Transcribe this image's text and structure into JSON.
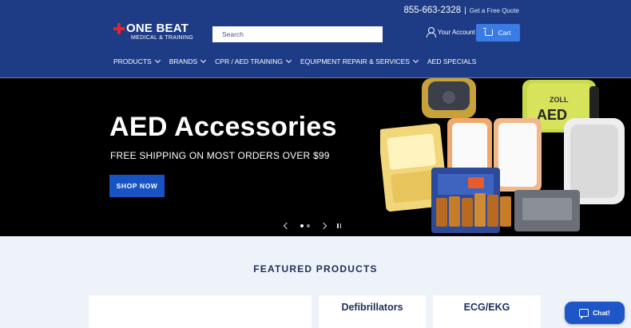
{
  "header": {
    "phone": "855-663-2328",
    "separator": "|",
    "quote_link": "Get a Free Quote",
    "logo_line1": "ONE BEAT",
    "logo_line2": "MEDICAL & TRAINING",
    "search_placeholder": "Search",
    "account_label": "Your Account",
    "cart_label": "Cart",
    "colors": {
      "header_bg": "#1d3c85",
      "logo_cross": "#e4232a",
      "cart_bg": "#3a7be6"
    }
  },
  "nav": {
    "items": [
      {
        "label": "PRODUCTS",
        "has_dropdown": true
      },
      {
        "label": "BRANDS",
        "has_dropdown": true
      },
      {
        "label": "CPR / AED TRAINING",
        "has_dropdown": true
      },
      {
        "label": "EQUIPMENT REPAIR & SERVICES",
        "has_dropdown": true
      },
      {
        "label": "AED SPECIALS",
        "has_dropdown": false
      }
    ]
  },
  "hero": {
    "title": "AED Accessories",
    "subtitle": "FREE SHIPPING ON MOST ORDERS OVER $99",
    "cta_label": "SHOP NOW",
    "product_label_zoll": "ZOLL",
    "product_label_aed": "AED",
    "slides_total": 2,
    "slide_active": 1
  },
  "featured": {
    "title": "FEATURED PRODUCTS",
    "cards": [
      "",
      "Defibrillators",
      "ECG/EKG"
    ]
  },
  "chat": {
    "label": "Chat!"
  }
}
